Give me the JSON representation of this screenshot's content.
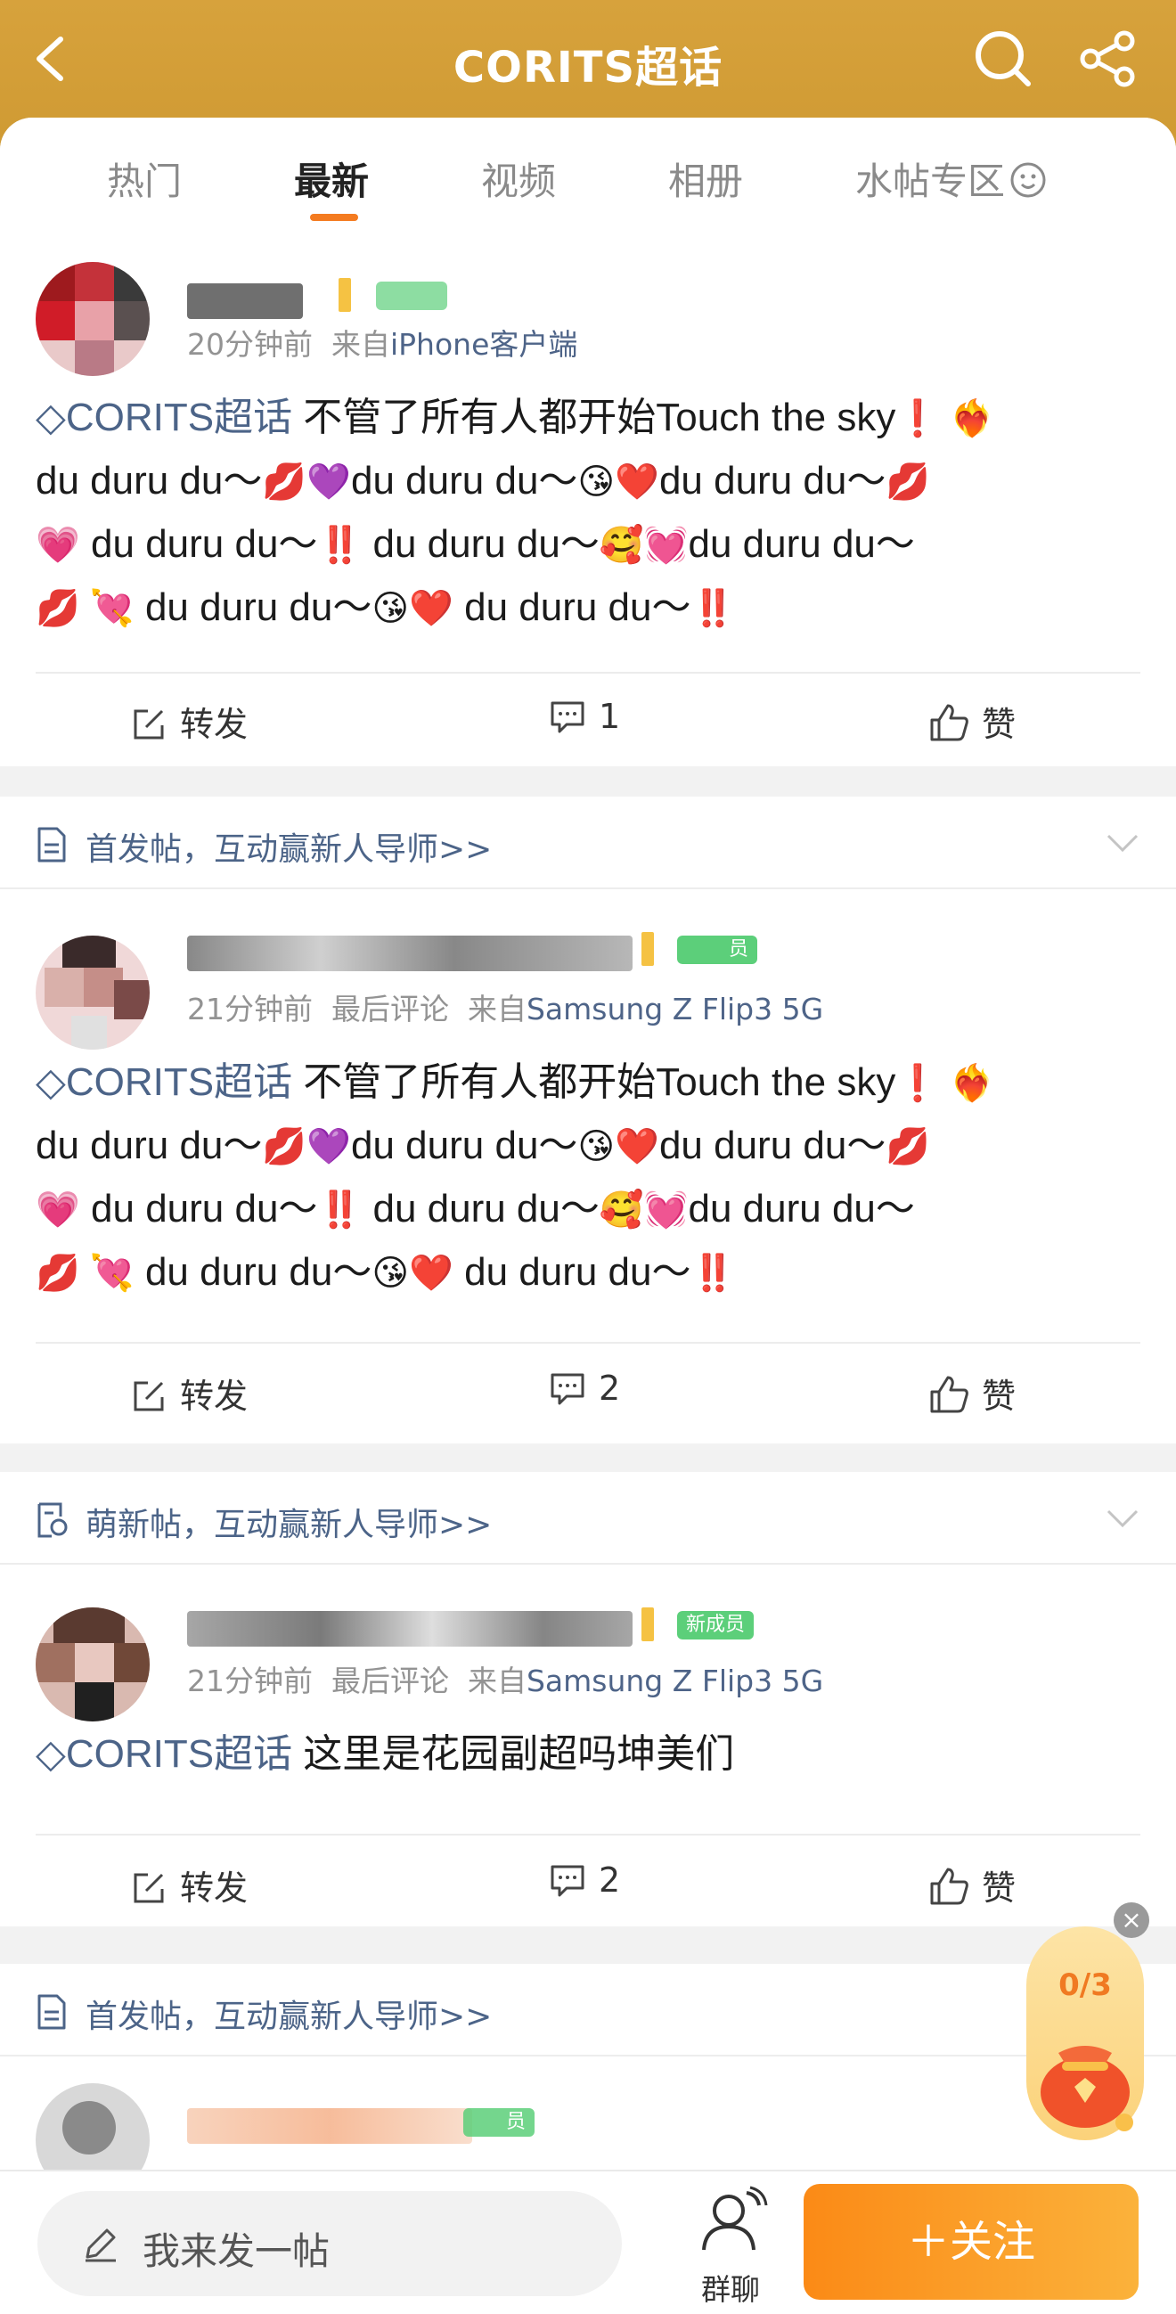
{
  "header": {
    "title": "CORITS超话"
  },
  "tabs": [
    {
      "label": "热门"
    },
    {
      "label": "最新"
    },
    {
      "label": "视频"
    },
    {
      "label": "相册"
    },
    {
      "label": "水帖专区"
    }
  ],
  "active_tab": "最新",
  "posts": [
    {
      "time": "20分钟前",
      "from_prefix": "来自",
      "source": "iPhone客户端",
      "tag": "CORITS超话",
      "text_1": " 不管了所有人都开始Touch the sky",
      "line_2": "du duru du～",
      "line_2b": "du duru du～",
      "line_2c": "du duru du～",
      "line_3a": " du duru du～",
      "line_3b": " du duru du～",
      "line_3c": "du duru du～",
      "line_4a": " du duru du～",
      "line_4b": " du duru du～",
      "repost": "转发",
      "comments": "1",
      "like": "赞"
    },
    {
      "section": "首发帖，互动赢新人导师>>",
      "time": "21分钟前",
      "last_comment": "最后评论",
      "from_prefix": "来自",
      "source": "Samsung Z Flip3 5G",
      "badge": "员",
      "tag": "CORITS超话",
      "text_1": " 不管了所有人都开始Touch the sky",
      "line_2": "du duru du～",
      "line_2b": "du duru du～",
      "line_2c": "du duru du～",
      "line_3a": " du duru du～",
      "line_3b": " du duru du～",
      "line_3c": "du duru du～",
      "line_4a": " du duru du～",
      "line_4b": " du duru du～",
      "repost": "转发",
      "comments": "2",
      "like": "赞"
    },
    {
      "section": "萌新帖，互动赢新人导师>>",
      "time": "21分钟前",
      "last_comment": "最后评论",
      "from_prefix": "来自",
      "source": "Samsung Z Flip3 5G",
      "badge": "新成员",
      "tag": "CORITS超话",
      "text": " 这里是花园副超吗坤美们",
      "repost": "转发",
      "comments": "2",
      "like": "赞"
    },
    {
      "section": "首发帖，互动赢新人导师>>",
      "badge": "员"
    }
  ],
  "float": {
    "count": "0/3",
    "close": "×"
  },
  "bottom": {
    "compose": "我来发一帖",
    "group": "群聊",
    "follow": "＋关注"
  },
  "colors": {
    "header": "#d49f38",
    "accent": "#f47b20",
    "link": "#4c6488",
    "follow": "#fb9a22"
  }
}
